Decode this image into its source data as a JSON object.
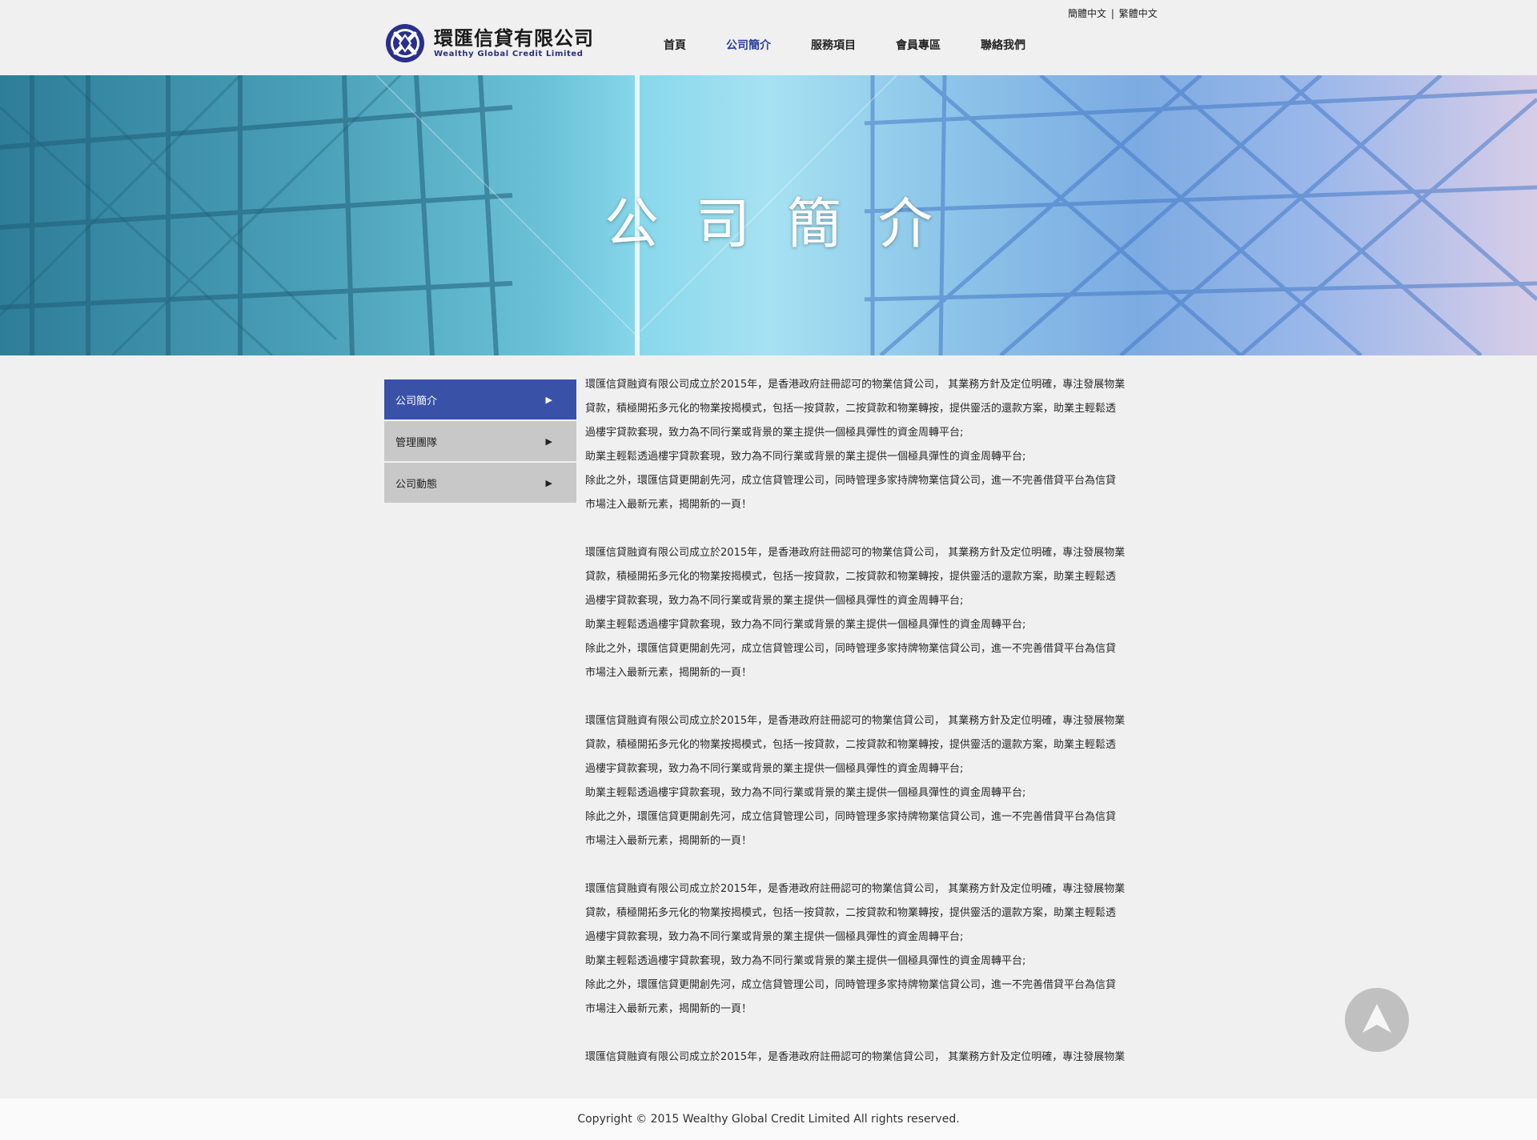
{
  "header": {
    "lang_simplified": "簡體中文",
    "lang_separator": "|",
    "lang_traditional": "繁體中文",
    "logo_cn": "環匯信貸有限公司",
    "logo_en": "Wealthy Global Credit Limited",
    "nav": [
      "首頁",
      "公司簡介",
      "服務項目",
      "會員專區",
      "聯絡我們"
    ],
    "nav_active": "公司簡介"
  },
  "banner": {
    "title": "公司簡介"
  },
  "sidebar": {
    "items": [
      {
        "label": "公司簡介",
        "arrow": "▶"
      },
      {
        "label": "管理團隊",
        "arrow": "▶"
      },
      {
        "label": "公司動態",
        "arrow": "▶"
      }
    ]
  },
  "content": {
    "paragraphs": [
      [
        "環匯信貸融資有限公司成立於2015年，是香港政府註冊認可的物業信貸公司， 其業務方針及定位明確，專注發展物業",
        "貸款，積極開拓多元化的物業按揭模式，包括一按貸款，二按貸款和物業轉按，提供靈活的還款方案，助業主輕鬆透",
        "過樓宇貸款套現，致力為不同行業或背景的業主提供一個極具彈性的資金周轉平台;",
        "助業主輕鬆透過樓宇貸款套現，致力為不同行業或背景的業主提供一個極具彈性的資金周轉平台;",
        "除此之外，環匯信貸更開創先河，成立信貸管理公司，同時管理多家持牌物業信貸公司，進一不完善借貸平台為信貸",
        "市場注入最新元素，揭開新的一頁！"
      ],
      [
        "環匯信貸融資有限公司成立於2015年，是香港政府註冊認可的物業信貸公司， 其業務方針及定位明確，專注發展物業",
        "貸款，積極開拓多元化的物業按揭模式，包括一按貸款，二按貸款和物業轉按，提供靈活的還款方案，助業主輕鬆透",
        "過樓宇貸款套現，致力為不同行業或背景的業主提供一個極具彈性的資金周轉平台;",
        "助業主輕鬆透過樓宇貸款套現，致力為不同行業或背景的業主提供一個極具彈性的資金周轉平台;",
        "除此之外，環匯信貸更開創先河，成立信貸管理公司，同時管理多家持牌物業信貸公司，進一不完善借貸平台為信貸",
        "市場注入最新元素，揭開新的一頁！"
      ],
      [
        "環匯信貸融資有限公司成立於2015年，是香港政府註冊認可的物業信貸公司， 其業務方針及定位明確，專注發展物業",
        "貸款，積極開拓多元化的物業按揭模式，包括一按貸款，二按貸款和物業轉按，提供靈活的還款方案，助業主輕鬆透",
        "過樓宇貸款套現，致力為不同行業或背景的業主提供一個極具彈性的資金周轉平台;",
        "助業主輕鬆透過樓宇貸款套現，致力為不同行業或背景的業主提供一個極具彈性的資金周轉平台;",
        "除此之外，環匯信貸更開創先河，成立信貸管理公司，同時管理多家持牌物業信貸公司，進一不完善借貸平台為信貸",
        "市場注入最新元素，揭開新的一頁！"
      ],
      [
        "環匯信貸融資有限公司成立於2015年，是香港政府註冊認可的物業信貸公司， 其業務方針及定位明確，專注發展物業",
        "貸款，積極開拓多元化的物業按揭模式，包括一按貸款，二按貸款和物業轉按，提供靈活的還款方案，助業主輕鬆透",
        "過樓宇貸款套現，致力為不同行業或背景的業主提供一個極具彈性的資金周轉平台;",
        "助業主輕鬆透過樓宇貸款套現，致力為不同行業或背景的業主提供一個極具彈性的資金周轉平台;",
        "除此之外，環匯信貸更開創先河，成立信貸管理公司，同時管理多家持牌物業信貸公司，進一不完善借貸平台為信貸",
        "市場注入最新元素，揭開新的一頁！"
      ],
      [
        "環匯信貸融資有限公司成立於2015年，是香港政府註冊認可的物業信貸公司， 其業務方針及定位明確，專注發展物業"
      ]
    ]
  },
  "footer": {
    "copyright": "Copyright © 2015 Wealthy Global Credit Limited All rights reserved."
  },
  "icons": {
    "logo": "logo-icon",
    "back_to_top": "arrow-up-icon",
    "sidebar_arrow": "triangle-right-icon"
  },
  "colors": {
    "accent": "#3a51a8",
    "nav_active": "#2b3f9e",
    "background": "#f0f0f0",
    "sidebar_item": "#c8c8c8"
  }
}
